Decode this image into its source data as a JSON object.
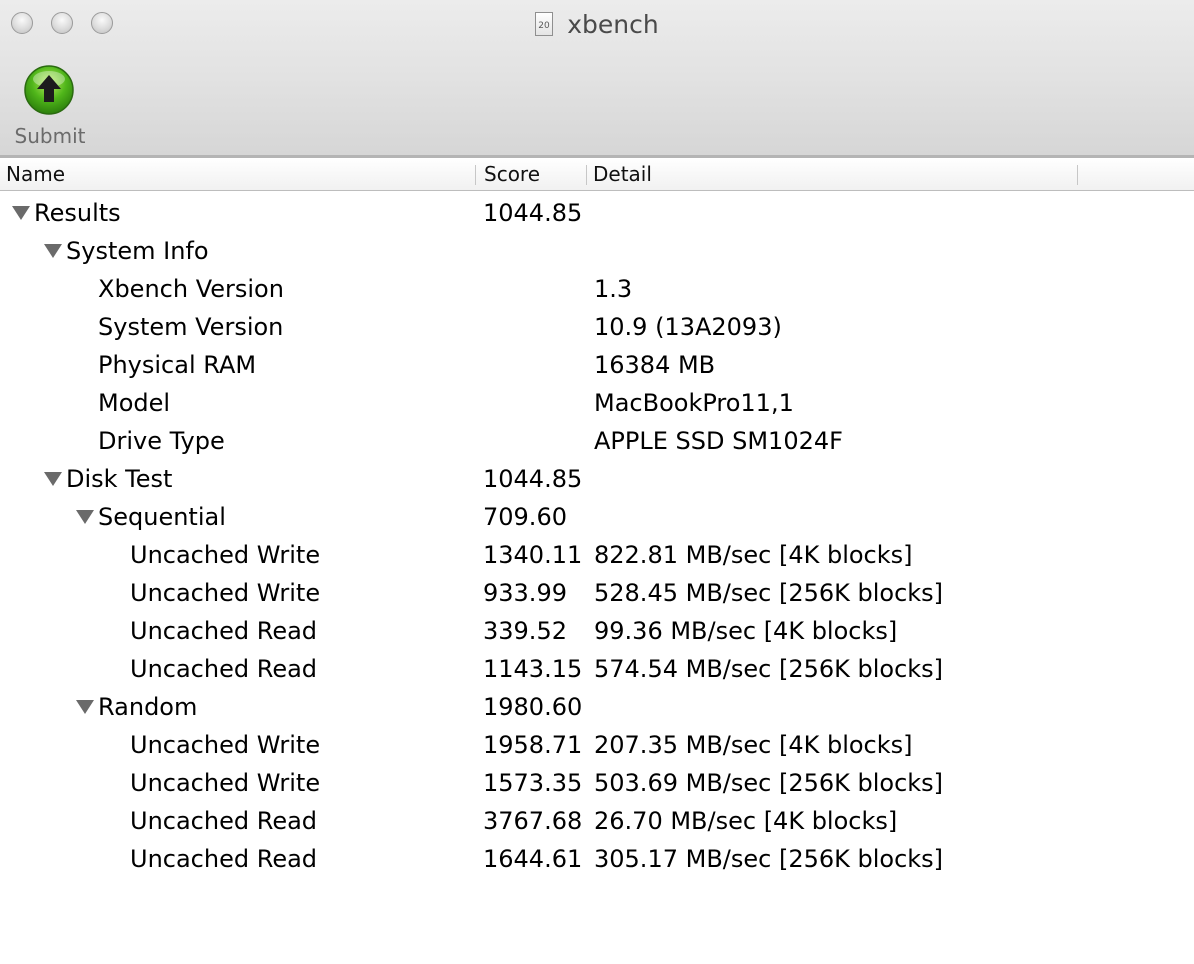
{
  "window": {
    "title": "xbench",
    "doc_icon_text": "20"
  },
  "toolbar": {
    "submit_label": "Submit"
  },
  "table": {
    "columns": [
      "Name",
      "Score",
      "Detail"
    ],
    "rows": [
      {
        "name": "Results",
        "score": "1044.85",
        "detail": "",
        "level": 0,
        "expandable": true
      },
      {
        "name": "System Info",
        "score": "",
        "detail": "",
        "level": 1,
        "expandable": true
      },
      {
        "name": "Xbench Version",
        "score": "",
        "detail": "1.3",
        "level": 2,
        "expandable": false
      },
      {
        "name": "System Version",
        "score": "",
        "detail": "10.9 (13A2093)",
        "level": 2,
        "expandable": false
      },
      {
        "name": "Physical RAM",
        "score": "",
        "detail": "16384 MB",
        "level": 2,
        "expandable": false
      },
      {
        "name": "Model",
        "score": "",
        "detail": "MacBookPro11,1",
        "level": 2,
        "expandable": false
      },
      {
        "name": "Drive Type",
        "score": "",
        "detail": "APPLE SSD SM1024F",
        "level": 2,
        "expandable": false
      },
      {
        "name": "Disk Test",
        "score": "1044.85",
        "detail": "",
        "level": 1,
        "expandable": true
      },
      {
        "name": "Sequential",
        "score": "709.60",
        "detail": "",
        "level": 2,
        "expandable": true
      },
      {
        "name": "Uncached Write",
        "score": "1340.11",
        "detail": "822.81 MB/sec [4K blocks]",
        "level": 3,
        "expandable": false
      },
      {
        "name": "Uncached Write",
        "score": "933.99",
        "detail": "528.45 MB/sec [256K blocks]",
        "level": 3,
        "expandable": false
      },
      {
        "name": "Uncached Read",
        "score": "339.52",
        "detail": "99.36 MB/sec [4K blocks]",
        "level": 3,
        "expandable": false
      },
      {
        "name": "Uncached Read",
        "score": "1143.15",
        "detail": "574.54 MB/sec [256K blocks]",
        "level": 3,
        "expandable": false
      },
      {
        "name": "Random",
        "score": "1980.60",
        "detail": "",
        "level": 2,
        "expandable": true
      },
      {
        "name": "Uncached Write",
        "score": "1958.71",
        "detail": "207.35 MB/sec [4K blocks]",
        "level": 3,
        "expandable": false
      },
      {
        "name": "Uncached Write",
        "score": "1573.35",
        "detail": "503.69 MB/sec [256K blocks]",
        "level": 3,
        "expandable": false
      },
      {
        "name": "Uncached Read",
        "score": "3767.68",
        "detail": "26.70 MB/sec [4K blocks]",
        "level": 3,
        "expandable": false
      },
      {
        "name": "Uncached Read",
        "score": "1644.61",
        "detail": "305.17 MB/sec [256K blocks]",
        "level": 3,
        "expandable": false
      }
    ]
  },
  "colors": {
    "submit_green": "#3ea312",
    "chrome_gradient_top": "#ececec",
    "chrome_gradient_bottom": "#d6d6d6"
  },
  "icons": {
    "submit": "green-up-arrow-icon",
    "disclosure": "disclosure-triangle-down-icon",
    "window_controls": [
      "close-button",
      "minimize-button",
      "zoom-button"
    ]
  }
}
